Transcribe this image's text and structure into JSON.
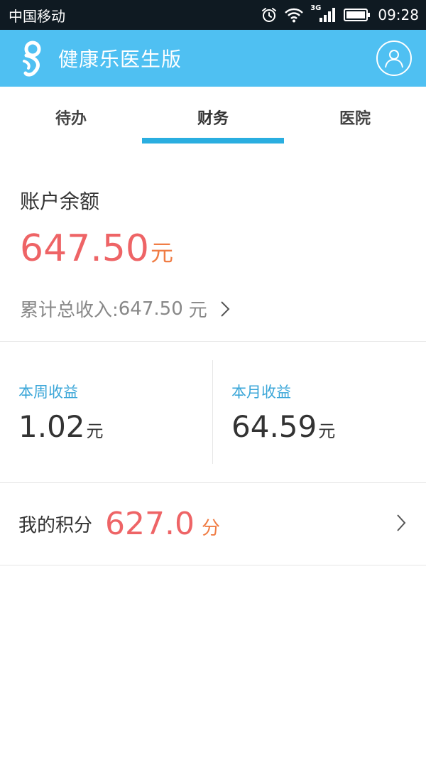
{
  "status_bar": {
    "carrier": "中国移动",
    "network": "3G",
    "time": "09:28",
    "icons": [
      "alarm-icon",
      "wifi-icon",
      "signal-icon",
      "battery-icon"
    ]
  },
  "app_bar": {
    "title": "健康乐医生版",
    "background_color": "#4fc0f2",
    "icons": [
      "app-logo-icon",
      "profile-icon"
    ]
  },
  "tabs": [
    {
      "label": "待办",
      "active": false
    },
    {
      "label": "财务",
      "active": true
    },
    {
      "label": "医院",
      "active": false
    }
  ],
  "balance": {
    "label": "账户余额",
    "amount": "647.50",
    "unit": "元",
    "total_income_label": "累计总收入:",
    "total_income_amount": "647.50",
    "total_income_unit": "元"
  },
  "earnings": [
    {
      "label": "本周收益",
      "amount": "1.02",
      "unit": "元"
    },
    {
      "label": "本月收益",
      "amount": "64.59",
      "unit": "元"
    }
  ],
  "points": {
    "label": "我的积分",
    "amount": "627.0",
    "unit": "分"
  },
  "colors": {
    "accent_blue": "#2aaee0",
    "amount_red": "#ee6466",
    "unit_orange": "#f07d45"
  }
}
